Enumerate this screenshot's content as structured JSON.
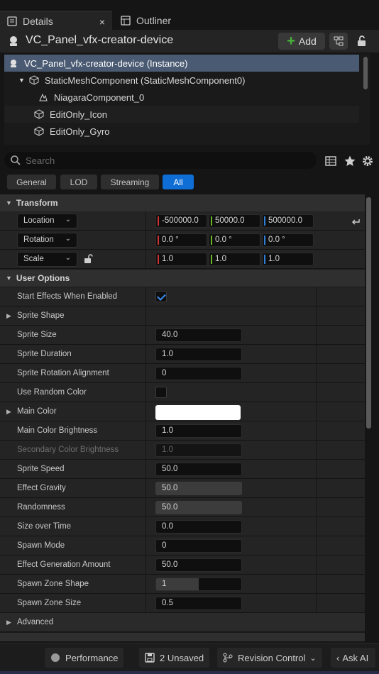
{
  "tabs": {
    "details": "Details",
    "outliner": "Outliner",
    "close": "×"
  },
  "header": {
    "actor_name": "VC_Panel_vfx-creator-device",
    "add_label": "Add"
  },
  "tree": {
    "items": [
      "VC_Panel_vfx-creator-device (Instance)",
      "StaticMeshComponent (StaticMeshComponent0)",
      "NiagaraComponent_0",
      "EditOnly_Icon",
      "EditOnly_Gyro"
    ]
  },
  "search": {
    "placeholder": "Search"
  },
  "filters": {
    "general": "General",
    "lod": "LOD",
    "streaming": "Streaming",
    "all": "All"
  },
  "transform": {
    "title": "Transform",
    "location": {
      "label": "Location",
      "x": "-500000.0",
      "y": "50000.0",
      "z": "500000.0"
    },
    "rotation": {
      "label": "Rotation",
      "x": "0.0 °",
      "y": "0.0 °",
      "z": "0.0 °"
    },
    "scale": {
      "label": "Scale",
      "x": "1.0",
      "y": "1.0",
      "z": "1.0"
    }
  },
  "user_options": {
    "title": "User Options",
    "start_effects": "Start Effects When Enabled",
    "sprite_shape": "Sprite Shape",
    "sprite_size": {
      "label": "Sprite Size",
      "value": "40.0"
    },
    "sprite_duration": {
      "label": "Sprite Duration",
      "value": "1.0"
    },
    "sprite_rotation": {
      "label": "Sprite Rotation Alignment",
      "value": "0"
    },
    "random_color": "Use Random Color",
    "main_color": "Main Color",
    "main_brightness": {
      "label": "Main Color Brightness",
      "value": "1.0"
    },
    "secondary_brightness": {
      "label": "Secondary Color Brightness",
      "value": "1.0"
    },
    "sprite_speed": {
      "label": "Sprite Speed",
      "value": "50.0"
    },
    "effect_gravity": {
      "label": "Effect Gravity",
      "value": "50.0"
    },
    "randomness": {
      "label": "Randomness",
      "value": "50.0"
    },
    "size_over_time": {
      "label": "Size over Time",
      "value": "0.0"
    },
    "spawn_mode": {
      "label": "Spawn Mode",
      "value": "0"
    },
    "generation_amount": {
      "label": "Effect Generation Amount",
      "value": "50.0"
    },
    "spawn_zone_shape": {
      "label": "Spawn Zone Shape",
      "value": "1"
    },
    "spawn_zone_size": {
      "label": "Spawn Zone Size",
      "value": "0.5"
    }
  },
  "advanced": "Advanced",
  "statusbar": {
    "performance": "Performance",
    "unsaved": "2 Unsaved",
    "revision": "Revision Control",
    "ask_ai": "Ask AI"
  },
  "colors": {
    "accent": "#0f6ed6",
    "selection": "#4a5a72",
    "add_plus": "#49b33b"
  }
}
